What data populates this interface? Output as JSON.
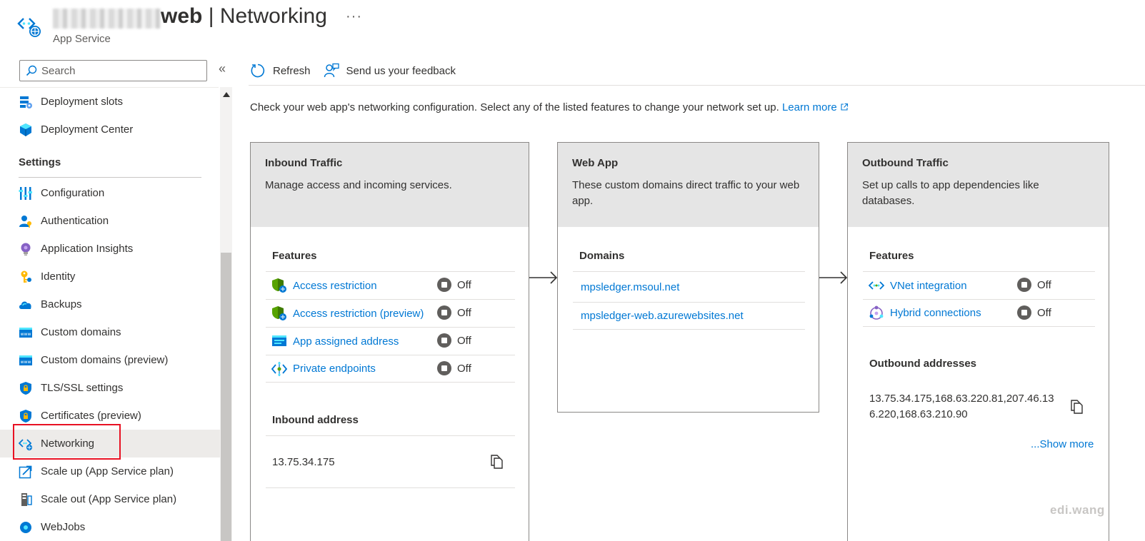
{
  "header": {
    "title_bold": "web",
    "title_rest": " | Networking",
    "subtitle": "App Service",
    "more": "···"
  },
  "sidebar": {
    "search_placeholder": "Search",
    "collapse": "«",
    "section": "Settings",
    "items": [
      {
        "label": "Deployment slots",
        "icon": "deployment-slots-icon"
      },
      {
        "label": "Deployment Center",
        "icon": "deployment-center-icon"
      },
      {
        "label": "Configuration",
        "icon": "configuration-icon"
      },
      {
        "label": "Authentication",
        "icon": "authentication-icon"
      },
      {
        "label": "Application Insights",
        "icon": "lightbulb-icon"
      },
      {
        "label": "Identity",
        "icon": "key-icon"
      },
      {
        "label": "Backups",
        "icon": "cloud-backup-icon"
      },
      {
        "label": "Custom domains",
        "icon": "www-icon"
      },
      {
        "label": "Custom domains (preview)",
        "icon": "www-icon"
      },
      {
        "label": "TLS/SSL settings",
        "icon": "shield-lock-icon"
      },
      {
        "label": "Certificates (preview)",
        "icon": "shield-lock-icon"
      },
      {
        "label": "Networking",
        "icon": "networking-icon",
        "selected": true
      },
      {
        "label": "Scale up (App Service plan)",
        "icon": "scale-up-icon"
      },
      {
        "label": "Scale out (App Service plan)",
        "icon": "scale-out-icon"
      },
      {
        "label": "WebJobs",
        "icon": "webjobs-icon"
      }
    ]
  },
  "toolbar": {
    "refresh": "Refresh",
    "feedback": "Send us your feedback"
  },
  "description": {
    "text": "Check your web app's networking configuration. Select any of the listed features to change your network set up. ",
    "link": "Learn more"
  },
  "inbound": {
    "title": "Inbound Traffic",
    "desc": "Manage access and incoming services.",
    "features_label": "Features",
    "features": [
      {
        "label": "Access restriction",
        "status": "Off"
      },
      {
        "label": "Access restriction (preview)",
        "status": "Off"
      },
      {
        "label": "App assigned address",
        "status": "Off"
      },
      {
        "label": "Private endpoints",
        "status": "Off"
      }
    ],
    "address_label": "Inbound address",
    "address": "13.75.34.175"
  },
  "webapp": {
    "title": "Web App",
    "desc": "These custom domains direct traffic to your web app.",
    "domains_label": "Domains",
    "domains": [
      "mpsledger.msoul.net",
      "mpsledger-web.azurewebsites.net"
    ]
  },
  "outbound": {
    "title": "Outbound Traffic",
    "desc": "Set up calls to app dependencies like databases.",
    "features_label": "Features",
    "features": [
      {
        "label": "VNet integration",
        "status": "Off"
      },
      {
        "label": "Hybrid connections",
        "status": "Off"
      }
    ],
    "addresses_label": "Outbound addresses",
    "addresses_line1": "13.75.34.175,168.63.220.81,207.46.13",
    "addresses_line2": "6.220,168.63.210.90",
    "show_more": "...Show more"
  },
  "watermark": "edi.wang",
  "colors": {
    "link": "#0078d4",
    "highlight": "#e81123",
    "card_header": "#e5e5e5"
  }
}
